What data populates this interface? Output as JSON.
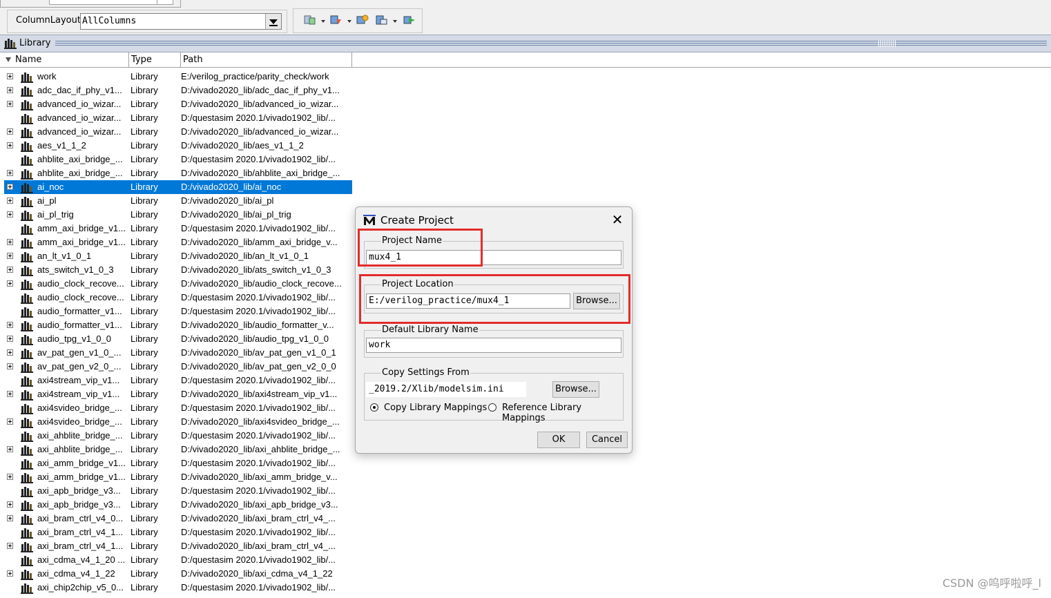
{
  "toolbar": {
    "column_layout_label": "ColumnLayout",
    "column_layout_value": "AllColumns",
    "icons": [
      "library-dropdown-icon",
      "compile-dropdown-icon",
      "simulate-icon",
      "edit-dropdown-icon",
      "refresh-icon"
    ]
  },
  "library_panel": {
    "title": "Library",
    "columns": [
      "Name",
      "Type",
      "Path"
    ],
    "rows": [
      {
        "name": "work",
        "type": "Library",
        "path": "E:/verilog_practice/parity_check/work",
        "expandable": true
      },
      {
        "name": "adc_dac_if_phy_v1...",
        "type": "Library",
        "path": "D:/vivado2020_lib/adc_dac_if_phy_v1...",
        "expandable": true
      },
      {
        "name": "advanced_io_wizar...",
        "type": "Library",
        "path": "D:/vivado2020_lib/advanced_io_wizar...",
        "expandable": true
      },
      {
        "name": "advanced_io_wizar...",
        "type": "Library",
        "path": "D:/questasim 2020.1/vivado1902_lib/...",
        "expandable": false
      },
      {
        "name": "advanced_io_wizar...",
        "type": "Library",
        "path": "D:/vivado2020_lib/advanced_io_wizar...",
        "expandable": true
      },
      {
        "name": "aes_v1_1_2",
        "type": "Library",
        "path": "D:/vivado2020_lib/aes_v1_1_2",
        "expandable": true
      },
      {
        "name": "ahblite_axi_bridge_...",
        "type": "Library",
        "path": "D:/questasim 2020.1/vivado1902_lib/...",
        "expandable": false
      },
      {
        "name": "ahblite_axi_bridge_...",
        "type": "Library",
        "path": "D:/vivado2020_lib/ahblite_axi_bridge_...",
        "expandable": true
      },
      {
        "name": "ai_noc",
        "type": "Library",
        "path": "D:/vivado2020_lib/ai_noc",
        "expandable": true,
        "selected": true
      },
      {
        "name": "ai_pl",
        "type": "Library",
        "path": "D:/vivado2020_lib/ai_pl",
        "expandable": true
      },
      {
        "name": "ai_pl_trig",
        "type": "Library",
        "path": "D:/vivado2020_lib/ai_pl_trig",
        "expandable": true
      },
      {
        "name": "amm_axi_bridge_v1...",
        "type": "Library",
        "path": "D:/questasim 2020.1/vivado1902_lib/...",
        "expandable": false
      },
      {
        "name": "amm_axi_bridge_v1...",
        "type": "Library",
        "path": "D:/vivado2020_lib/amm_axi_bridge_v...",
        "expandable": true
      },
      {
        "name": "an_lt_v1_0_1",
        "type": "Library",
        "path": "D:/vivado2020_lib/an_lt_v1_0_1",
        "expandable": true
      },
      {
        "name": "ats_switch_v1_0_3",
        "type": "Library",
        "path": "D:/vivado2020_lib/ats_switch_v1_0_3",
        "expandable": true
      },
      {
        "name": "audio_clock_recove...",
        "type": "Library",
        "path": "D:/vivado2020_lib/audio_clock_recove...",
        "expandable": true
      },
      {
        "name": "audio_clock_recove...",
        "type": "Library",
        "path": "D:/questasim 2020.1/vivado1902_lib/...",
        "expandable": false
      },
      {
        "name": "audio_formatter_v1...",
        "type": "Library",
        "path": "D:/questasim 2020.1/vivado1902_lib/...",
        "expandable": false
      },
      {
        "name": "audio_formatter_v1...",
        "type": "Library",
        "path": "D:/vivado2020_lib/audio_formatter_v...",
        "expandable": true
      },
      {
        "name": "audio_tpg_v1_0_0",
        "type": "Library",
        "path": "D:/vivado2020_lib/audio_tpg_v1_0_0",
        "expandable": true
      },
      {
        "name": "av_pat_gen_v1_0_...",
        "type": "Library",
        "path": "D:/vivado2020_lib/av_pat_gen_v1_0_1",
        "expandable": true
      },
      {
        "name": "av_pat_gen_v2_0_...",
        "type": "Library",
        "path": "D:/vivado2020_lib/av_pat_gen_v2_0_0",
        "expandable": true
      },
      {
        "name": "axi4stream_vip_v1...",
        "type": "Library",
        "path": "D:/questasim 2020.1/vivado1902_lib/...",
        "expandable": false
      },
      {
        "name": "axi4stream_vip_v1...",
        "type": "Library",
        "path": "D:/vivado2020_lib/axi4stream_vip_v1...",
        "expandable": true
      },
      {
        "name": "axi4svideo_bridge_...",
        "type": "Library",
        "path": "D:/questasim 2020.1/vivado1902_lib/...",
        "expandable": false
      },
      {
        "name": "axi4svideo_bridge_...",
        "type": "Library",
        "path": "D:/vivado2020_lib/axi4svideo_bridge_...",
        "expandable": true
      },
      {
        "name": "axi_ahblite_bridge_...",
        "type": "Library",
        "path": "D:/questasim 2020.1/vivado1902_lib/...",
        "expandable": false
      },
      {
        "name": "axi_ahblite_bridge_...",
        "type": "Library",
        "path": "D:/vivado2020_lib/axi_ahblite_bridge_...",
        "expandable": true
      },
      {
        "name": "axi_amm_bridge_v1...",
        "type": "Library",
        "path": "D:/questasim 2020.1/vivado1902_lib/...",
        "expandable": false
      },
      {
        "name": "axi_amm_bridge_v1...",
        "type": "Library",
        "path": "D:/vivado2020_lib/axi_amm_bridge_v...",
        "expandable": true
      },
      {
        "name": "axi_apb_bridge_v3...",
        "type": "Library",
        "path": "D:/questasim 2020.1/vivado1902_lib/...",
        "expandable": false
      },
      {
        "name": "axi_apb_bridge_v3...",
        "type": "Library",
        "path": "D:/vivado2020_lib/axi_apb_bridge_v3...",
        "expandable": true
      },
      {
        "name": "axi_bram_ctrl_v4_0...",
        "type": "Library",
        "path": "D:/vivado2020_lib/axi_bram_ctrl_v4_...",
        "expandable": true
      },
      {
        "name": "axi_bram_ctrl_v4_1...",
        "type": "Library",
        "path": "D:/questasim 2020.1/vivado1902_lib/...",
        "expandable": false
      },
      {
        "name": "axi_bram_ctrl_v4_1...",
        "type": "Library",
        "path": "D:/vivado2020_lib/axi_bram_ctrl_v4_...",
        "expandable": true
      },
      {
        "name": "axi_cdma_v4_1_20 ...",
        "type": "Library",
        "path": "D:/questasim 2020.1/vivado1902_lib/...",
        "expandable": false
      },
      {
        "name": "axi_cdma_v4_1_22",
        "type": "Library",
        "path": "D:/vivado2020_lib/axi_cdma_v4_1_22",
        "expandable": true
      },
      {
        "name": "axi_chip2chip_v5_0...",
        "type": "Library",
        "path": "D:/questasim 2020.1/vivado1902_lib/...",
        "expandable": false
      }
    ]
  },
  "dialog": {
    "title": "Create Project",
    "project_name_label": "Project Name",
    "project_name_value": "mux4_1",
    "project_location_label": "Project Location",
    "project_location_value": "E:/verilog_practice/mux4_1",
    "browse_label": "Browse...",
    "default_library_label": "Default Library Name",
    "default_library_value": "work",
    "copy_settings_label": "Copy Settings From",
    "copy_settings_value": "_2019.2/Xlib/modelsim.ini",
    "copy_browse_label": "Browse...",
    "radio_copy_label": "Copy Library Mappings",
    "radio_reference_label": "Reference Library Mappings",
    "ok_label": "OK",
    "cancel_label": "Cancel"
  },
  "watermark": "CSDN @呜呼啦呼_l",
  "colors": {
    "selection": "#0078d7",
    "highlight_box": "#e32b2b",
    "panel_header": "#d4dbe6"
  }
}
